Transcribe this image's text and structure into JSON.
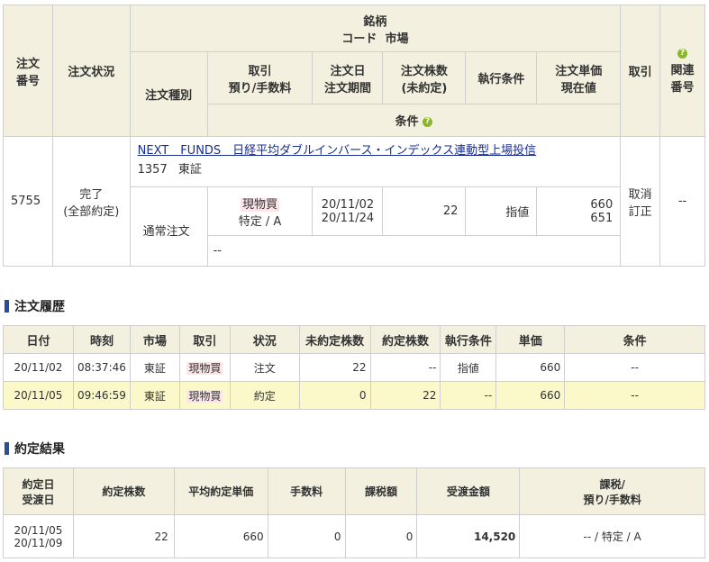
{
  "main_table": {
    "headers": {
      "order_no": "注文番号",
      "order_status": "注文状況",
      "issue": "銘柄",
      "code_market": "コード  市場",
      "order_type": "注文種別",
      "trade_fee": "取引預り/手数料",
      "order_date_period": "注文日注文期間",
      "order_qty": "注文株数(未約定)",
      "exec_condition": "執行条件",
      "unit_price_current": "注文単価現在値",
      "trade": "取引",
      "related_no": "関連番号",
      "condition": "条件"
    },
    "header_lines": {
      "order_no": [
        "注文",
        "番号"
      ],
      "trade_fee": [
        "取引",
        "預り/手数料"
      ],
      "order_date_period": [
        "注文日",
        "注文期間"
      ],
      "order_qty": [
        "注文株数",
        "(未約定)"
      ],
      "unit_price_current": [
        "注文単価",
        "現在値"
      ],
      "related_no": [
        "関連",
        "番号"
      ]
    },
    "row": {
      "order_no": "5755",
      "status_line1": "完了",
      "status_line2": "(全部約定)",
      "issue_name": "NEXT　FUNDS　日経平均ダブルインバース・インデックス連動型上場投信",
      "code": "1357",
      "market": "東証",
      "order_type": "通常注文",
      "trade": "現物買",
      "account": "特定 / A",
      "order_date": "20/11/02",
      "period": "20/11/24",
      "qty": "22",
      "exec_condition": "指値",
      "unit_price": "660",
      "current_price": "651",
      "cancel": "取消",
      "correct": "訂正",
      "related": "--",
      "condition": "--"
    }
  },
  "history": {
    "title": "注文履歴",
    "columns": [
      "日付",
      "時刻",
      "市場",
      "取引",
      "状況",
      "未約定株数",
      "約定株数",
      "執行条件",
      "単価",
      "条件"
    ],
    "rows": [
      {
        "date": "20/11/02",
        "time": "08:37:46",
        "market": "東証",
        "trade": "現物買",
        "status": "注文",
        "unfilled": "22",
        "filled": "--",
        "exec": "指値",
        "price": "660",
        "cond": "--"
      },
      {
        "date": "20/11/05",
        "time": "09:46:59",
        "market": "東証",
        "trade": "現物買",
        "status": "約定",
        "unfilled": "0",
        "filled": "22",
        "exec": "--",
        "price": "660",
        "cond": "--"
      }
    ]
  },
  "result": {
    "title": "約定結果",
    "columns": {
      "date": [
        "約定日",
        "受渡日"
      ],
      "qty": "約定株数",
      "avg_price": "平均約定単価",
      "fee": "手数料",
      "tax": "課税額",
      "amount": "受渡金額",
      "tax_type": [
        "課税/",
        "預り/手数料"
      ]
    },
    "row": {
      "exec_date": "20/11/05",
      "delivery_date": "20/11/09",
      "qty": "22",
      "avg_price": "660",
      "fee": "0",
      "tax": "0",
      "amount": "14,520",
      "tax_type": "-- / 特定 / A"
    }
  },
  "colors": {
    "header_bg": "#f3f0df",
    "highlight_row": "#fbf8c9",
    "buy_bg": "#fce5e8",
    "accent_bar": "#2a4d9b",
    "help_icon": "#8ab72b"
  }
}
